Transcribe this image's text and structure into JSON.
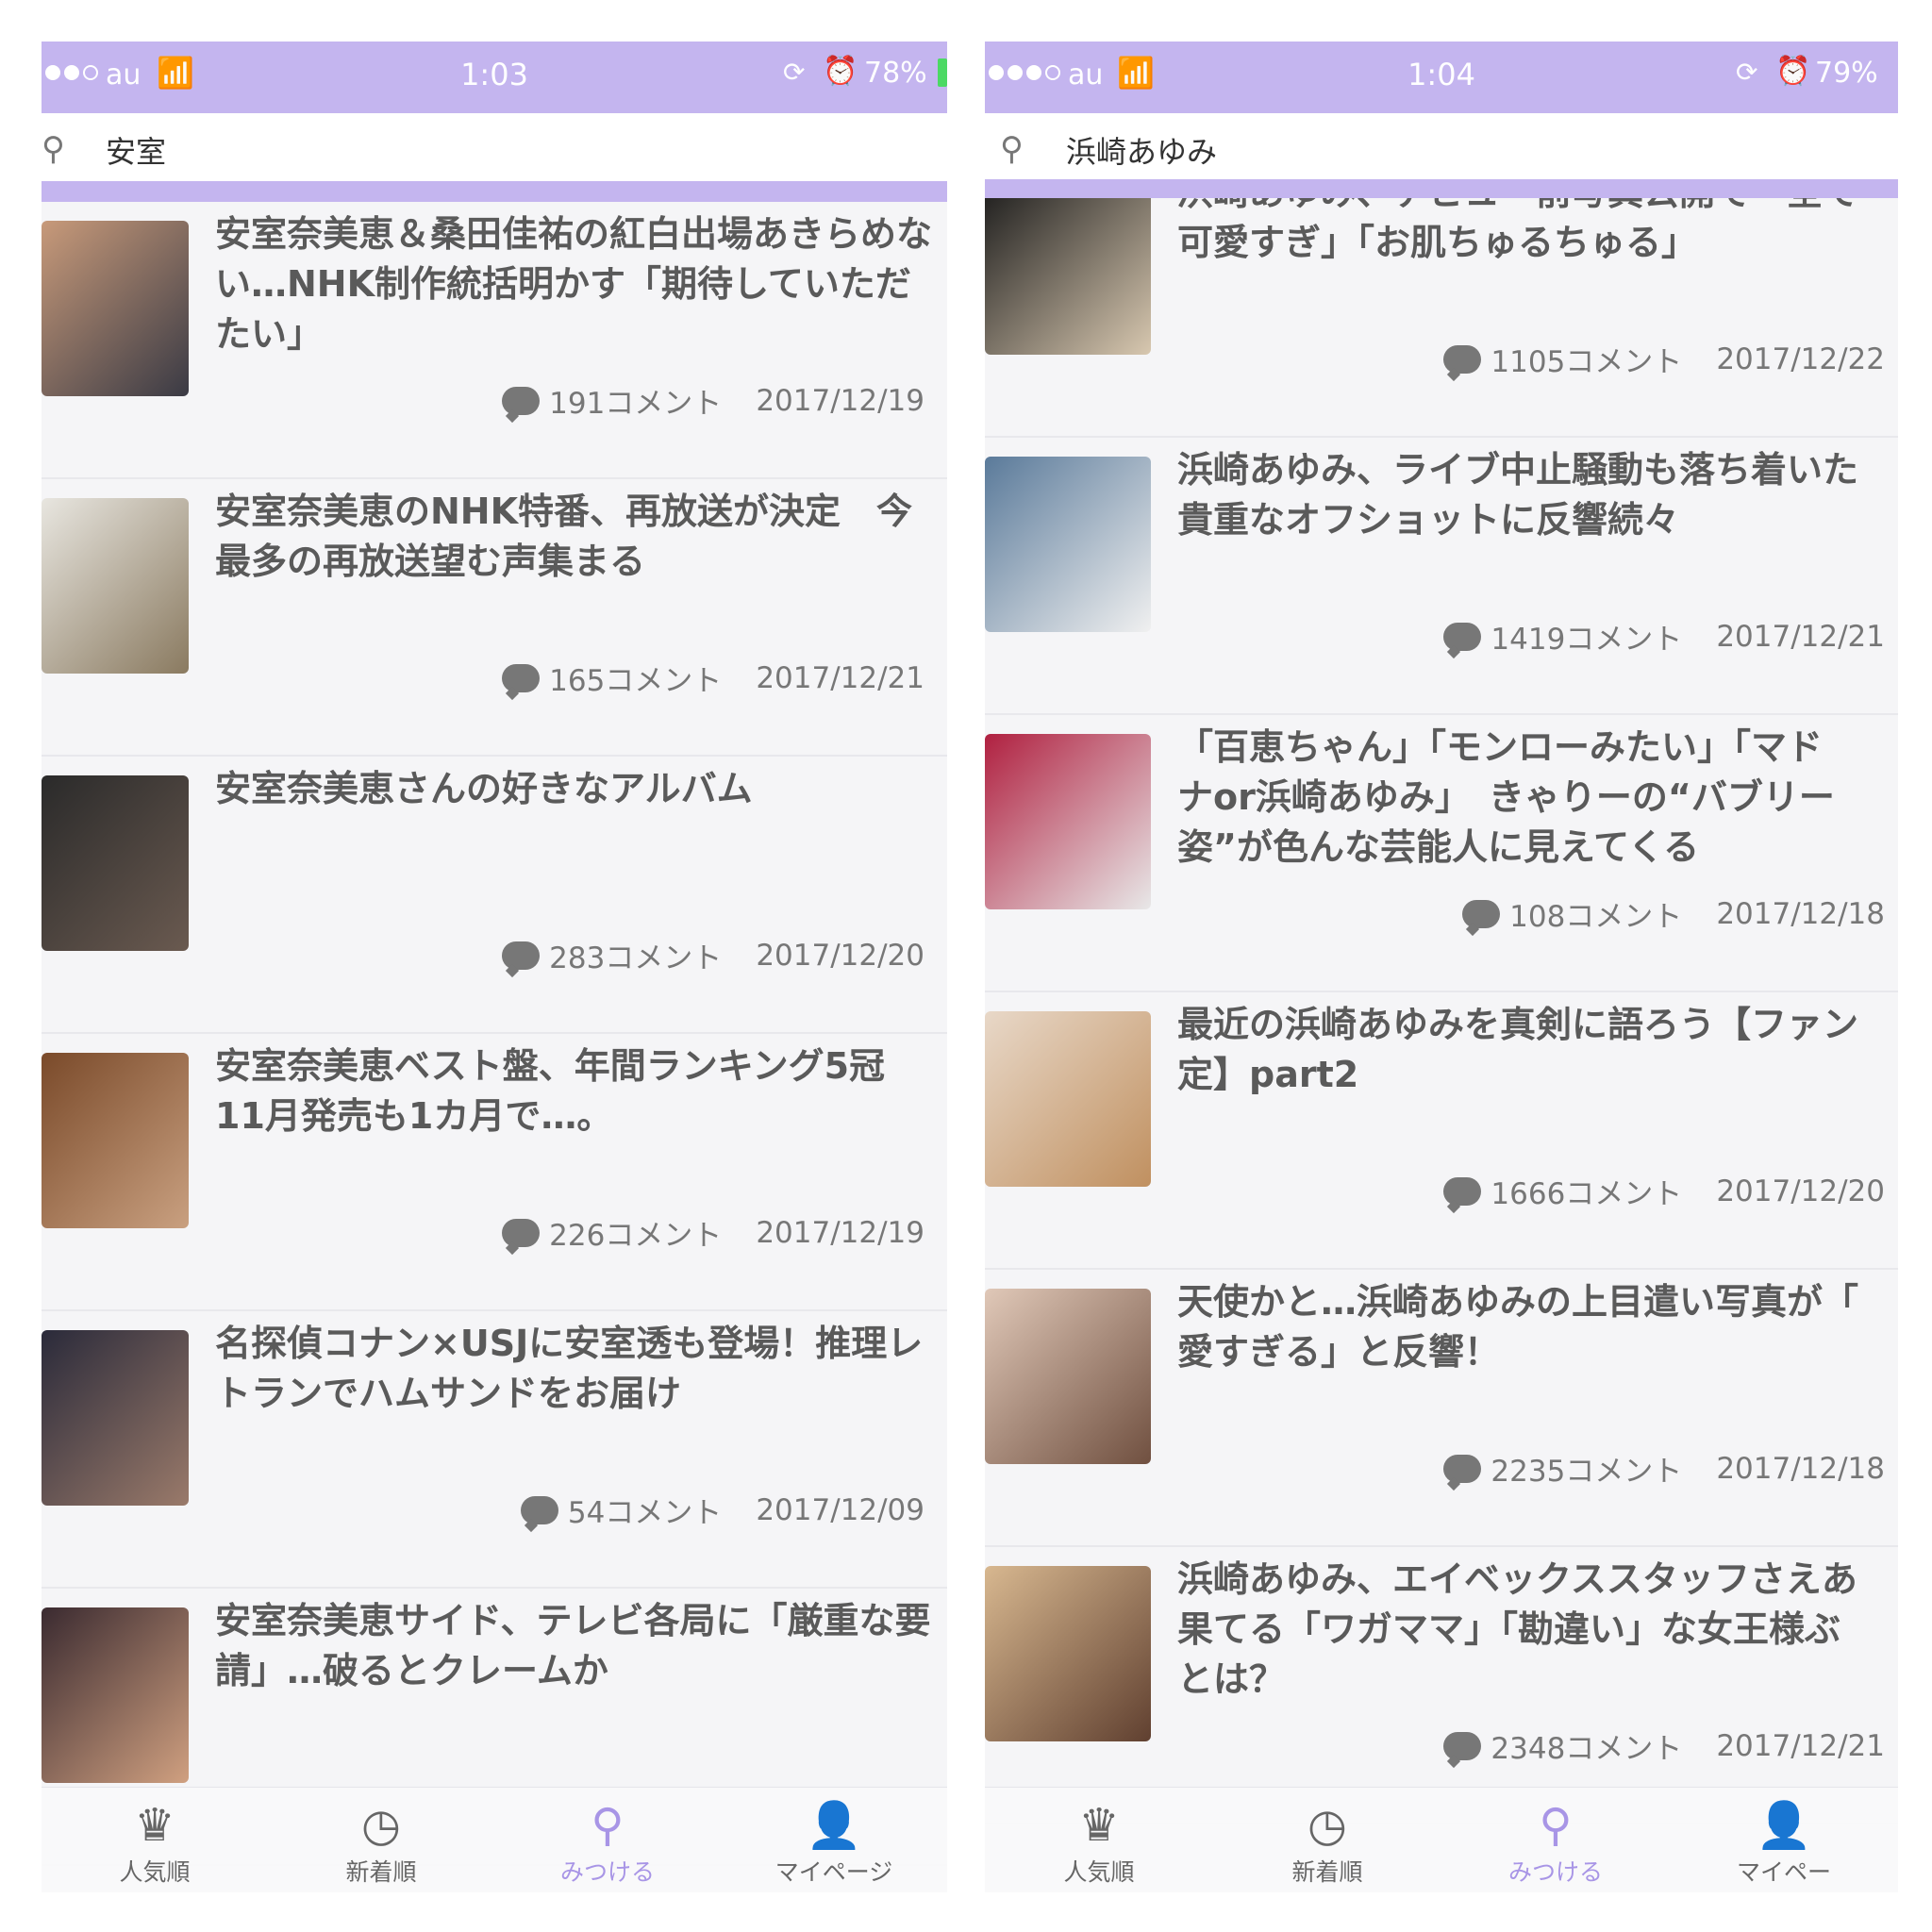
{
  "left": {
    "status": {
      "carrier": "au",
      "time": "1:03",
      "battery": "78%"
    },
    "search": {
      "query": "安室"
    },
    "articles": [
      {
        "title_lines": [
          "安室奈美恵＆桑田佳祐の紅白出場あきらめな",
          "い…NHK制作統括明かす「期待していただ",
          "たい」"
        ],
        "comments": "191コメント",
        "date": "2017/12/19"
      },
      {
        "title_lines": [
          "安室奈美恵のNHK特番、再放送が決定　今",
          "最多の再放送望む声集まる"
        ],
        "comments": "165コメント",
        "date": "2017/12/21"
      },
      {
        "title_lines": [
          "安室奈美恵さんの好きなアルバム"
        ],
        "comments": "283コメント",
        "date": "2017/12/20"
      },
      {
        "title_lines": [
          "安室奈美恵ベスト盤、年間ランキング5冠",
          "11月発売も1カ月で…。"
        ],
        "comments": "226コメント",
        "date": "2017/12/19"
      },
      {
        "title_lines": [
          "名探偵コナン×USJに安室透も登場！推理レ",
          "トランでハムサンドをお届け"
        ],
        "comments": "54コメント",
        "date": "2017/12/09"
      },
      {
        "title_lines": [
          "安室奈美恵サイド、テレビ各局に「厳重な要",
          "請」…破るとクレームか"
        ],
        "comments": "",
        "date": ""
      }
    ],
    "tabs": [
      "人気順",
      "新着順",
      "みつける",
      "マイページ"
    ]
  },
  "right": {
    "status": {
      "carrier": "au",
      "time": "1:04",
      "battery": "79%"
    },
    "search": {
      "query": "浜崎あゆみ"
    },
    "articles": [
      {
        "title_lines": [
          "浜崎あゆみ、デビュー前写真公開で「全て",
          "可愛すぎ」「お肌ちゅるちゅる」"
        ],
        "comments": "1105コメント",
        "date": "2017/12/22"
      },
      {
        "title_lines": [
          "浜崎あゆみ、ライブ中止騒動も落ち着いた",
          "貴重なオフショットに反響続々"
        ],
        "comments": "1419コメント",
        "date": "2017/12/21"
      },
      {
        "title_lines": [
          "「百恵ちゃん」「モンローみたい」「マド",
          "ナor浜崎あゆみ」　きゃりーの“バブリー",
          "姿”が色んな芸能人に見えてくる"
        ],
        "comments": "108コメント",
        "date": "2017/12/18"
      },
      {
        "title_lines": [
          "最近の浜崎あゆみを真剣に語ろう【ファン",
          "定】part2"
        ],
        "comments": "1666コメント",
        "date": "2017/12/20"
      },
      {
        "title_lines": [
          "天使かと…浜崎あゆみの上目遣い写真が「",
          "愛すぎる」と反響！"
        ],
        "comments": "2235コメント",
        "date": "2017/12/18"
      },
      {
        "title_lines": [
          "浜崎あゆみ、エイベックススタッフさえあ",
          "果てる「ワガママ」「勘違い」な女王様ぶ",
          "とは？"
        ],
        "comments": "2348コメント",
        "date": "2017/12/21"
      }
    ],
    "tabs": [
      "人気順",
      "新着順",
      "みつける",
      "マイペー"
    ]
  },
  "icons": {
    "popular": "crown-icon",
    "new": "clock-icon",
    "discover": "search-icon",
    "mypage": "person-icon",
    "comment": "speech-bubble-icon"
  },
  "colors": {
    "accent": "#c4b5ef",
    "active_tab": "#a895e6",
    "battery": "#4cd964"
  }
}
